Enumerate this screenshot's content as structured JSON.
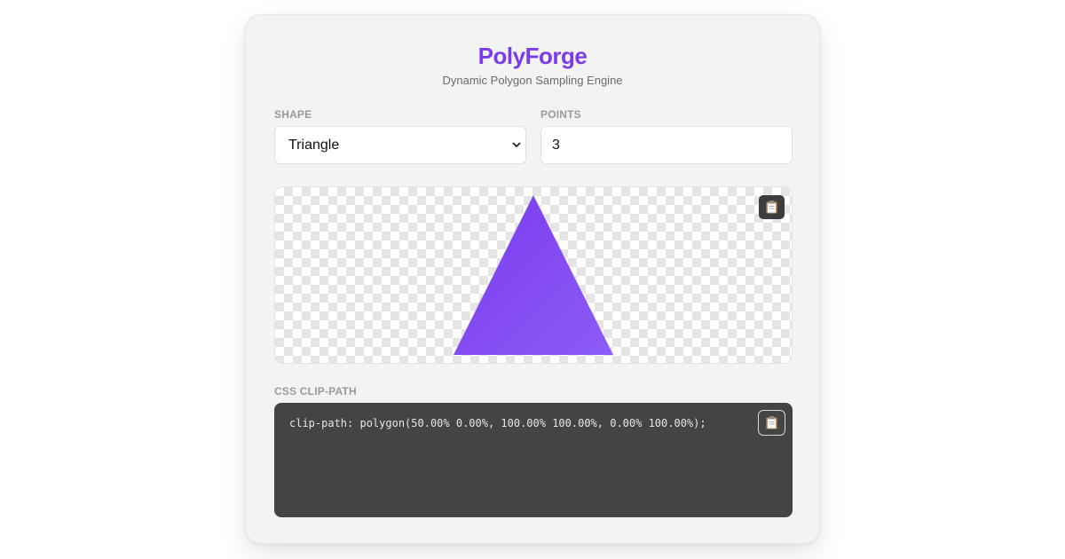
{
  "app": {
    "title": "PolyForge",
    "subtitle": "Dynamic Polygon Sampling Engine"
  },
  "controls": {
    "shape_label": "SHAPE",
    "shape_value": "Triangle",
    "points_label": "POINTS",
    "points_value": "3"
  },
  "preview": {
    "fill_start": "#7c3aed",
    "fill_end": "#8b5cf6",
    "copy_icon": "clipboard-icon"
  },
  "output": {
    "label": "CSS CLIP-PATH",
    "code": "clip-path: polygon(50.00% 0.00%, 100.00% 100.00%, 0.00% 100.00%);",
    "copy_icon": "clipboard-icon"
  },
  "colors": {
    "accent": "#7c3aed",
    "code_bg": "#444444",
    "card_bg": "#f3f3f3"
  }
}
